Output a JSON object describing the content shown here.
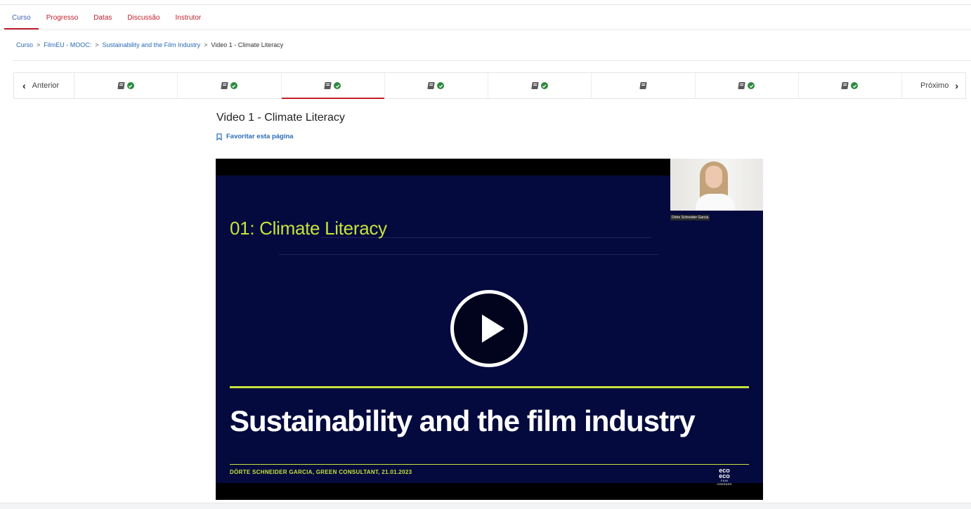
{
  "tabs": [
    {
      "label": "Curso",
      "active": true
    },
    {
      "label": "Progresso"
    },
    {
      "label": "Datas"
    },
    {
      "label": "Discussão"
    },
    {
      "label": "Instrutor"
    }
  ],
  "breadcrumb": {
    "items": [
      "Curso",
      "FilmEU - MOOC:",
      "Sustainability and the Film Industry"
    ],
    "current": "Video 1 - Climate Literacy",
    "separator": ">"
  },
  "sequence_nav": {
    "previous_label": "Anterior",
    "next_label": "Próximo",
    "items": [
      {
        "icon": "book-icon",
        "completed": true
      },
      {
        "icon": "book-icon",
        "completed": true
      },
      {
        "icon": "book-icon",
        "completed": true,
        "active": true
      },
      {
        "icon": "book-icon",
        "completed": true
      },
      {
        "icon": "book-icon",
        "completed": true
      },
      {
        "icon": "book-icon",
        "completed": false
      },
      {
        "icon": "book-icon",
        "completed": true
      },
      {
        "icon": "book-icon",
        "completed": true
      }
    ]
  },
  "unit": {
    "title": "Video 1 - Climate Literacy",
    "bookmark_label": "Favoritar esta página"
  },
  "video": {
    "slide_heading": "01: Climate Literacy",
    "slide_title": "Sustainability and the film industry",
    "slide_credit": "DÖRTE SCHNEIDER GARCIA, GREEN CONSULTANT, 21.01.2023",
    "logo_text_top": "eco",
    "logo_text_bottom": "eco",
    "logo_small": "FILM GREENER",
    "webcam_name": "Dörte Schneider Garcia",
    "play_icon": "play-icon"
  },
  "colors": {
    "accent_red": "#c0202c",
    "link_blue": "#2a6bb7",
    "slide_bg": "#040a3e",
    "slide_green": "#c6e23b",
    "check_green": "#2d8a3e"
  }
}
